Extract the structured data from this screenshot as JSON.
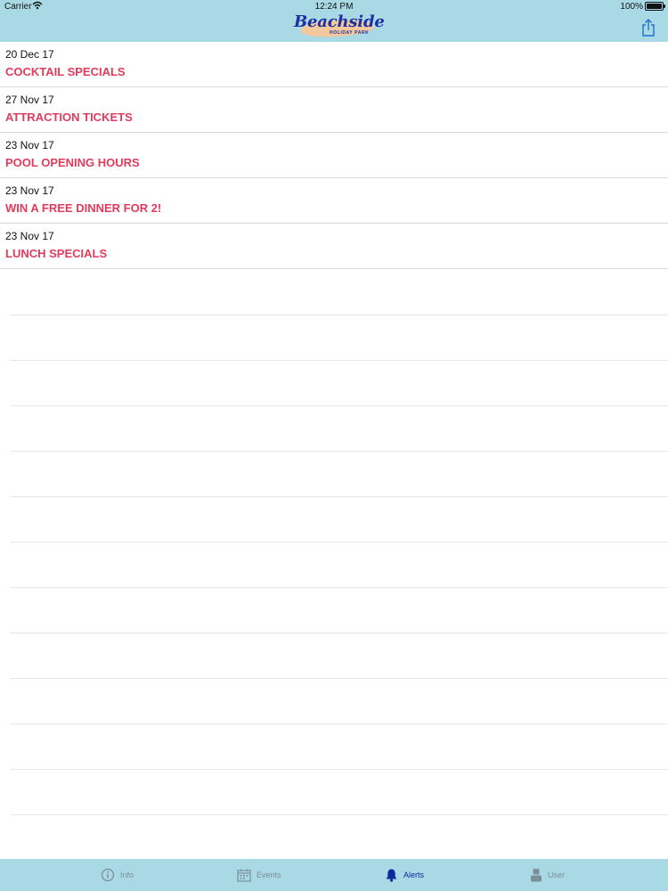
{
  "status_bar": {
    "carrier": "Carrier",
    "time": "12:24 PM",
    "battery_pct": "100%"
  },
  "header": {
    "logo_text": "Beachside",
    "logo_subtext": "HOLIDAY PARK"
  },
  "alerts": [
    {
      "date": "20 Dec 17",
      "title": "COCKTAIL SPECIALS"
    },
    {
      "date": "27 Nov 17",
      "title": "ATTRACTION TICKETS"
    },
    {
      "date": "23 Nov 17",
      "title": "POOL OPENING HOURS"
    },
    {
      "date": "23 Nov 17",
      "title": "WIN A FREE DINNER FOR 2!"
    },
    {
      "date": "23 Nov 17",
      "title": "LUNCH SPECIALS"
    }
  ],
  "tabs": [
    {
      "label": "Info",
      "icon": "info-icon",
      "active": false
    },
    {
      "label": "Events",
      "icon": "calendar-icon",
      "active": false
    },
    {
      "label": "Alerts",
      "icon": "bell-icon",
      "active": true
    },
    {
      "label": "User",
      "icon": "user-icon",
      "active": false
    }
  ],
  "colors": {
    "nav_bg": "#a9d9e5",
    "alert_title": "#e23b5d",
    "active_tab": "#0f2a9c",
    "inactive_tab": "#7c8e96"
  }
}
